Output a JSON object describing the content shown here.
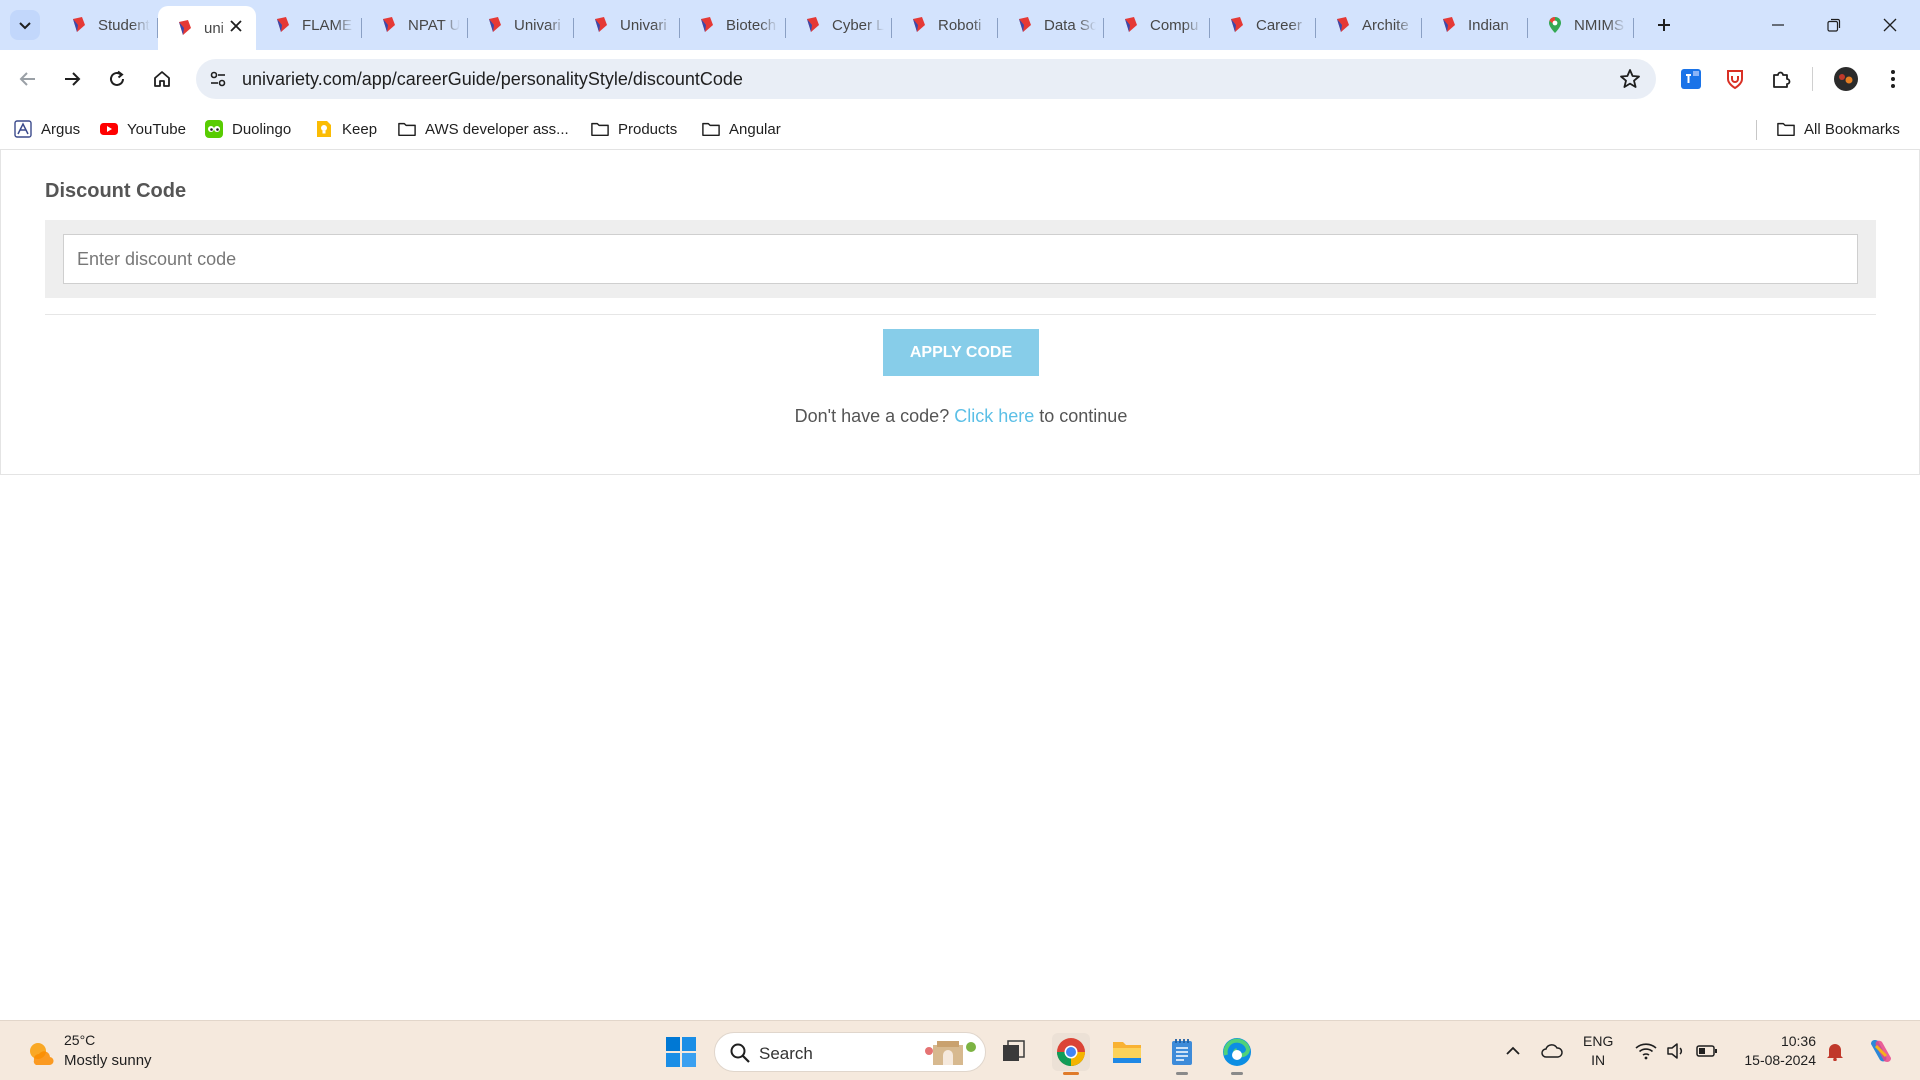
{
  "browser": {
    "tabs": [
      {
        "title": "Student",
        "icon": "univariety-icon"
      },
      {
        "title": "uni",
        "icon": "univariety-icon",
        "active": true
      },
      {
        "title": "FLAME",
        "icon": "univariety-icon"
      },
      {
        "title": "NPAT U",
        "icon": "univariety-icon"
      },
      {
        "title": "Univari",
        "icon": "univariety-icon"
      },
      {
        "title": "Univari",
        "icon": "univariety-icon"
      },
      {
        "title": "Biotech",
        "icon": "univariety-icon"
      },
      {
        "title": "Cyber L",
        "icon": "univariety-icon"
      },
      {
        "title": "Roboti",
        "icon": "univariety-icon"
      },
      {
        "title": "Data Sc",
        "icon": "univariety-icon"
      },
      {
        "title": "Compu",
        "icon": "univariety-icon"
      },
      {
        "title": "Career",
        "icon": "univariety-icon"
      },
      {
        "title": "Archite",
        "icon": "univariety-icon"
      },
      {
        "title": "Indian",
        "icon": "univariety-icon"
      },
      {
        "title": "NMIMS",
        "icon": "maps-pin-icon"
      }
    ],
    "url": "univariety.com/app/careerGuide/personalityStyle/discountCode",
    "bookmarks": [
      {
        "label": "Argus",
        "icon": "argus-icon"
      },
      {
        "label": "YouTube",
        "icon": "youtube-icon"
      },
      {
        "label": "Duolingo",
        "icon": "duolingo-icon"
      },
      {
        "label": "Keep",
        "icon": "keep-icon"
      },
      {
        "label": "AWS developer ass...",
        "icon": "folder-icon"
      },
      {
        "label": "Products",
        "icon": "folder-icon"
      },
      {
        "label": "Angular",
        "icon": "folder-icon"
      }
    ],
    "all_bookmarks": "All Bookmarks"
  },
  "page": {
    "section_title": "Discount Code",
    "discount_input": {
      "placeholder": "Enter discount code",
      "value": ""
    },
    "apply_button": "APPLY CODE",
    "continue_prefix": "Don't have a code?",
    "continue_link": "Click here",
    "continue_suffix": "to continue"
  },
  "taskbar": {
    "weather_temp": "25°C",
    "weather_desc": "Mostly sunny",
    "search_label": "Search",
    "lang_top": "ENG",
    "lang_bottom": "IN",
    "time": "10:36",
    "date": "15-08-2024"
  },
  "colors": {
    "tabstrip": "#d3e3fd",
    "apply_button": "#87cde9",
    "link": "#5bbfe6",
    "taskbar": "#f5e9dd"
  }
}
